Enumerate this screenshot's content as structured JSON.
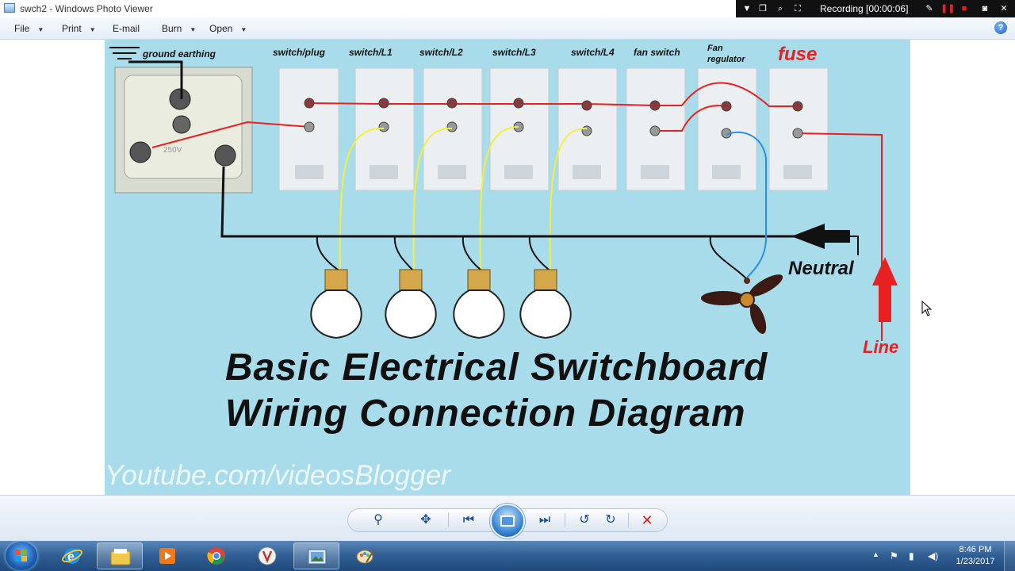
{
  "window": {
    "title": "swch2 - Windows Photo Viewer"
  },
  "recording": {
    "label": "Recording [00:00:06]"
  },
  "menu": {
    "file": "File",
    "print": "Print",
    "email": "E-mail",
    "burn": "Burn",
    "open": "Open"
  },
  "diagram": {
    "ground_label": "ground earthing",
    "switch_labels": [
      "switch/plug",
      "switch/L1",
      "switch/L2",
      "switch/L3",
      "switch/L4",
      "fan switch"
    ],
    "fan_regulator": "Fan regulator",
    "fuse": "fuse",
    "neutral": "Neutral",
    "line": "Line",
    "title_line1": "Basic Electrical Switchboard",
    "title_line2": "Wiring Connection Diagram",
    "watermark": "Youtube.com/videosBlogger",
    "colors": {
      "background": "#a9dcea",
      "line_wire": "#e82020",
      "switched_wire": "#f4ef3a",
      "neutral_wire": "#111111",
      "fan_wire": "#2a8fe0"
    }
  },
  "taskbar": {
    "time": "8:46 PM",
    "date": "1/23/2017",
    "apps": [
      "internet-explorer",
      "file-explorer",
      "media-player",
      "chrome",
      "app-v",
      "photo-viewer",
      "paint"
    ]
  }
}
